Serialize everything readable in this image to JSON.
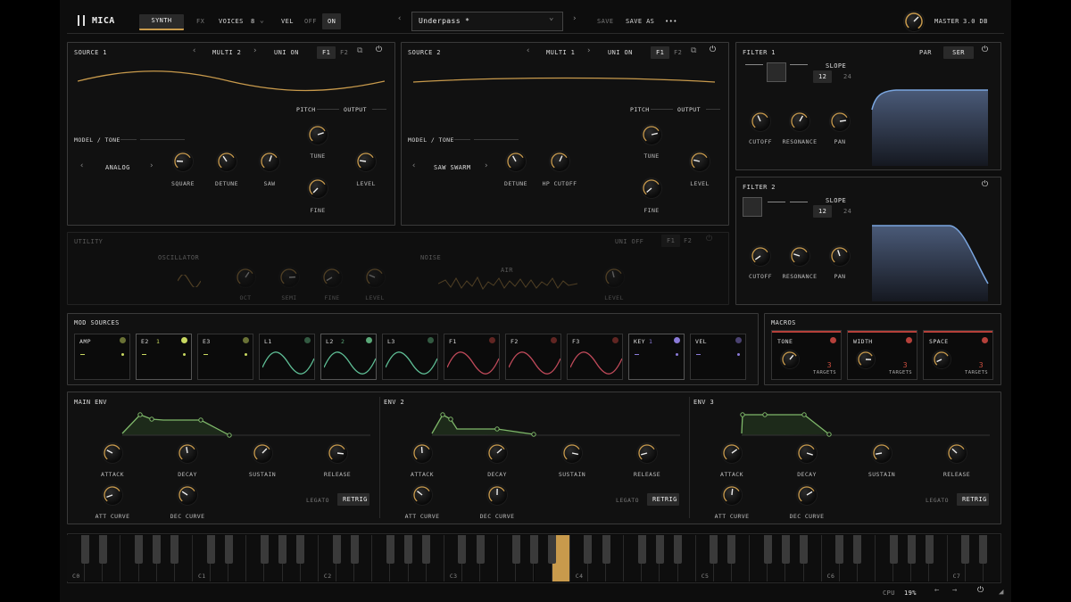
{
  "top": {
    "logo": "MICA",
    "tab_synth": "SYNTH",
    "tab_fx": "FX",
    "voices_label": "VOICES",
    "voices_value": "8",
    "vel_label": "VEL",
    "off": "OFF",
    "on": "ON",
    "preset": "Underpass *",
    "save": "SAVE",
    "save_as": "SAVE AS",
    "more": "•••",
    "master_label": "MASTER",
    "master_value": "3.0 dB"
  },
  "source1": {
    "title": "SOURCE 1",
    "mode": "MULTI 2",
    "uni": "UNI ON",
    "f1": "F1",
    "f2": "F2",
    "pitch": "PITCH",
    "output": "OUTPUT",
    "model_tone": "MODEL / TONE",
    "model": "ANALOG",
    "knobs": [
      "SQUARE",
      "DETUNE",
      "SAW"
    ],
    "tune": "TUNE",
    "fine": "FINE",
    "level": "LEVEL"
  },
  "source2": {
    "title": "SOURCE 2",
    "mode": "MULTI 1",
    "uni": "UNI ON",
    "f1": "F1",
    "f2": "F2",
    "pitch": "PITCH",
    "output": "OUTPUT",
    "model_tone": "MODEL / TONE",
    "model": "SAW SWARM",
    "knobs": [
      "DETUNE",
      "HP CUTOFF"
    ],
    "tune": "TUNE",
    "fine": "FINE",
    "level": "LEVEL"
  },
  "filter1": {
    "title": "FILTER 1",
    "par": "PAR",
    "ser": "SER",
    "slope": "SLOPE",
    "s12": "12",
    "s24": "24",
    "cutoff": "CUTOFF",
    "resonance": "RESONANCE",
    "pan": "PAN"
  },
  "filter2": {
    "title": "FILTER 2",
    "slope": "SLOPE",
    "s12": "12",
    "s24": "24",
    "cutoff": "CUTOFF",
    "resonance": "RESONANCE",
    "pan": "PAN"
  },
  "utility": {
    "title": "UTILITY",
    "uni": "UNI OFF",
    "f1": "F1",
    "f2": "F2",
    "oscillator": "OSCILLATOR",
    "oct": "OCT",
    "semi": "SEMI",
    "fine": "FINE",
    "level": "LEVEL",
    "noise": "NOISE",
    "air": "AIR",
    "nlevel": "LEVEL"
  },
  "mod": {
    "title": "MOD SOURCES",
    "cells": [
      {
        "label": "AMP",
        "n": ""
      },
      {
        "label": "E2",
        "n": "1"
      },
      {
        "label": "E3",
        "n": ""
      },
      {
        "label": "L1",
        "n": ""
      },
      {
        "label": "L2",
        "n": "2"
      },
      {
        "label": "L3",
        "n": ""
      },
      {
        "label": "F1",
        "n": ""
      },
      {
        "label": "F2",
        "n": ""
      },
      {
        "label": "F3",
        "n": ""
      },
      {
        "label": "KEY",
        "n": "1"
      },
      {
        "label": "VEL",
        "n": ""
      }
    ]
  },
  "macros": {
    "title": "MACROS",
    "items": [
      {
        "label": "TONE",
        "count": "3",
        "targets": "TARGETS"
      },
      {
        "label": "WIDTH",
        "count": "3",
        "targets": "TARGETS"
      },
      {
        "label": "SPACE",
        "count": "3",
        "targets": "TARGETS"
      }
    ]
  },
  "envs": [
    {
      "title": "MAIN ENV"
    },
    {
      "title": "ENV 2"
    },
    {
      "title": "ENV 3"
    }
  ],
  "env_labels": {
    "attack": "ATTACK",
    "decay": "DECAY",
    "sustain": "SUSTAIN",
    "release": "RELEASE",
    "att_curve": "ATT CURVE",
    "dec_curve": "DEC CURVE",
    "legato": "LEGATO",
    "retrig": "RETRIG"
  },
  "keyboard": {
    "octaves": [
      "C0",
      "C1",
      "C2",
      "C3",
      "C4",
      "C5",
      "C6",
      "C7"
    ]
  },
  "status": {
    "cpu_label": "CPU",
    "cpu_value": "19%"
  },
  "colors": {
    "gold": "#c89a4c",
    "green": "#7fb86a",
    "red": "#b5403a",
    "blue": "#7aa6e0"
  }
}
